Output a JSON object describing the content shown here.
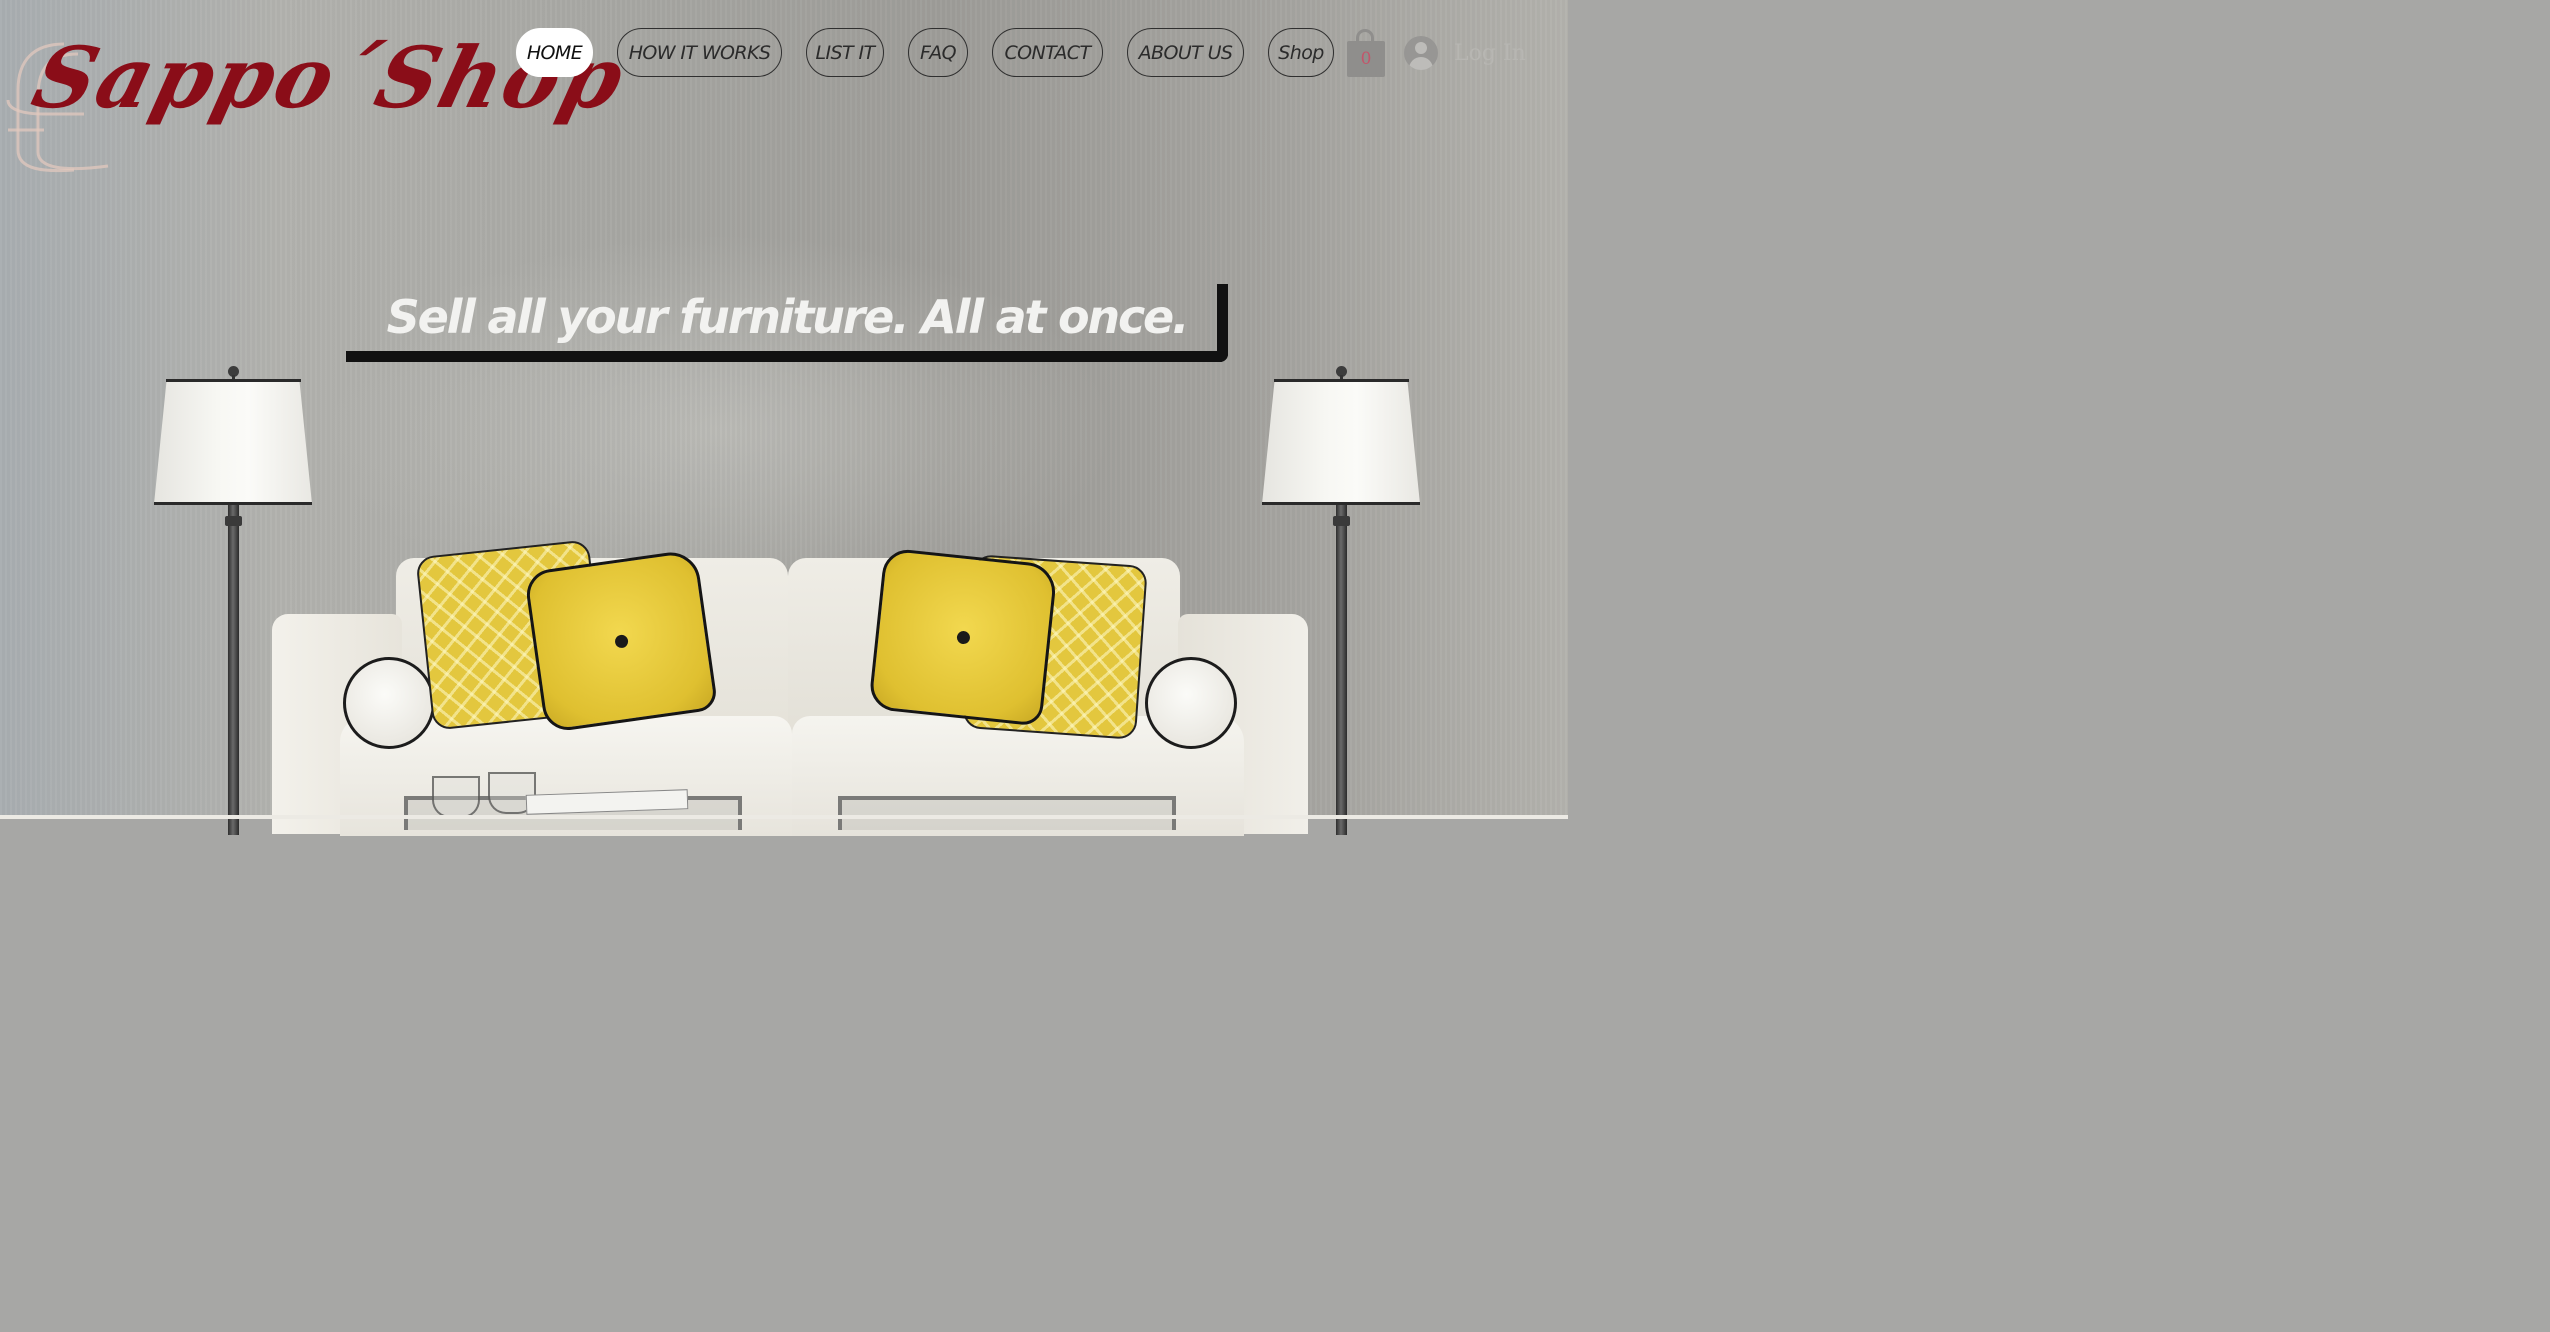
{
  "brand": {
    "logo_text": "Sappo´Shop",
    "colors": {
      "logo": "#8a0d18",
      "nav_active_bg": "#ffffff",
      "nav_border": "#2f2f2f",
      "cart_count": "#c2566b"
    }
  },
  "nav": {
    "items": [
      {
        "label": "HOME",
        "active": true
      },
      {
        "label": "HOW IT WORKS",
        "active": false
      },
      {
        "label": "LIST IT",
        "active": false
      },
      {
        "label": "FAQ",
        "active": false
      },
      {
        "label": "CONTACT",
        "active": false
      },
      {
        "label": "ABOUT US",
        "active": false
      },
      {
        "label": "Shop",
        "active": false
      }
    ]
  },
  "cart": {
    "icon": "shopping-bag-icon",
    "count": "0"
  },
  "login": {
    "icon": "user-avatar-icon",
    "label": "Log In"
  },
  "hero": {
    "headline": "Sell all your furniture. All at once.",
    "background": "living room with white sofa, yellow pillows and two floor lamps"
  }
}
